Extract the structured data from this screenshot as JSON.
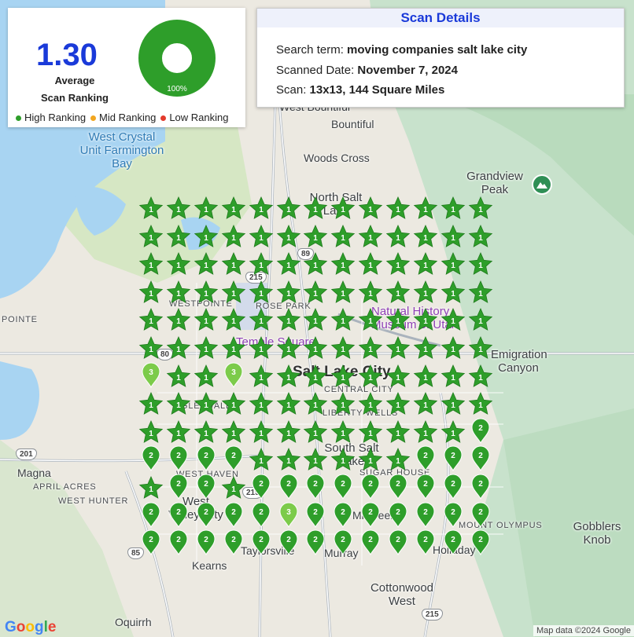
{
  "summary": {
    "average_rank": "1.30",
    "average_label_1": "Average",
    "average_label_2": "Scan Ranking",
    "donut_percent_label": "100%",
    "donut_fraction": 1.0,
    "legend": [
      {
        "label": "High Ranking",
        "color": "#2e9e2a"
      },
      {
        "label": "Mid Ranking",
        "color": "#f2a61f"
      },
      {
        "label": "Low Ranking",
        "color": "#e33a2c"
      }
    ]
  },
  "details": {
    "title": "Scan Details",
    "search_label": "Search term:",
    "search_value": "moving companies salt lake city",
    "date_label": "Scanned Date:",
    "date_value": "November 7, 2024",
    "scan_label": "Scan:",
    "scan_value": "13x13, 144 Square Miles"
  },
  "colors": {
    "accent": "#1a3ad9",
    "high": "#2e9e2a",
    "high_light": "#7ccb4a",
    "water": "#a8d4f2",
    "park": "#c9e6cf"
  },
  "map_labels": {
    "west_bountiful": "West Bountiful",
    "bountiful": "Bountiful",
    "woods_cross": "Woods Cross",
    "north_salt_lake": "North Salt Lake",
    "grandview_peak": "Grandview Peak",
    "west_crystal": "West Crystal Unit Farmington Bay",
    "westpointe": "WESTPOINTE",
    "rose_park": "ROSE PARK",
    "pointe": "POINTE",
    "natural_history": "Natural History Museum of Utah",
    "temple_square": "Temple Square",
    "salt_lake_city": "Salt Lake City",
    "central_city": "CENTRAL CITY",
    "liberty_wells": "LIBERTY WELLS",
    "emigration": "Emigration Canyon",
    "glendale": "GLENDALE",
    "south_salt_lake": "South Salt Lake",
    "sugar_house": "SUGAR HOUSE",
    "magna": "Magna",
    "april_acres": "APRIL ACRES",
    "west_hunter": "WEST HUNTER",
    "west_haven": "WEST HAVEN",
    "west_valley": "West Valley City",
    "millcreek": "Millcreek",
    "mt_olympus": "MOUNT OLYMPUS",
    "gobblers": "Gobblers Knob",
    "kearns": "Kearns",
    "taylorsville": "Taylorsville",
    "murray": "Murray",
    "holladay": "Holladay",
    "cottonwood": "Cottonwood West",
    "oquirrh": "Oquirrh",
    "rt_201": "201",
    "rt_215a": "215",
    "rt_215b": "215",
    "rt_215c": "215",
    "rt_80": "80",
    "rt_89": "89",
    "rt_85": "85",
    "google": "Google",
    "attribution": "Map data ©2024 Google"
  },
  "grid": {
    "cols": 13,
    "rows": 13,
    "ranks": [
      [
        1,
        1,
        1,
        1,
        1,
        1,
        1,
        1,
        1,
        1,
        1,
        1,
        1
      ],
      [
        1,
        1,
        1,
        1,
        1,
        1,
        1,
        1,
        1,
        1,
        1,
        1,
        1
      ],
      [
        1,
        1,
        1,
        1,
        1,
        1,
        1,
        1,
        1,
        1,
        1,
        1,
        1
      ],
      [
        1,
        1,
        1,
        1,
        1,
        1,
        1,
        1,
        1,
        1,
        1,
        1,
        1
      ],
      [
        1,
        1,
        1,
        1,
        1,
        1,
        1,
        1,
        1,
        1,
        1,
        1,
        1
      ],
      [
        1,
        1,
        1,
        1,
        1,
        1,
        1,
        1,
        1,
        1,
        1,
        1,
        1
      ],
      [
        3,
        1,
        1,
        3,
        1,
        1,
        1,
        1,
        1,
        1,
        1,
        1,
        1
      ],
      [
        1,
        1,
        1,
        1,
        1,
        1,
        1,
        1,
        1,
        1,
        1,
        1,
        1
      ],
      [
        1,
        1,
        1,
        1,
        1,
        1,
        1,
        1,
        1,
        1,
        1,
        1,
        2
      ],
      [
        2,
        2,
        2,
        2,
        1,
        1,
        1,
        1,
        1,
        1,
        2,
        2,
        2
      ],
      [
        1,
        2,
        2,
        1,
        2,
        2,
        2,
        2,
        2,
        2,
        2,
        2,
        2
      ],
      [
        2,
        2,
        2,
        2,
        2,
        3,
        2,
        2,
        2,
        2,
        2,
        2,
        2
      ],
      [
        2,
        2,
        2,
        2,
        2,
        2,
        2,
        2,
        2,
        2,
        2,
        2,
        2
      ]
    ]
  }
}
